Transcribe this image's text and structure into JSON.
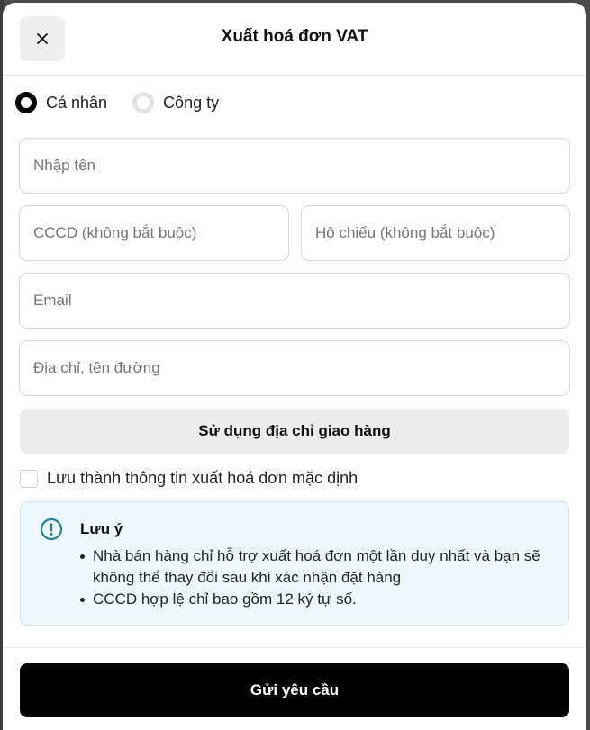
{
  "header": {
    "title": "Xuất hoá đơn VAT",
    "close_icon": "close-icon"
  },
  "customer_type": {
    "options": [
      {
        "label": "Cá nhân",
        "selected": true
      },
      {
        "label": "Công ty",
        "selected": false
      }
    ]
  },
  "form": {
    "name_placeholder": "Nhập tên",
    "cccd_placeholder": "CCCD (không bắt buộc)",
    "passport_placeholder": "Hộ chiếu (không bắt buộc)",
    "email_placeholder": "Email",
    "address_placeholder": "Địa chỉ, tên đường",
    "use_shipping_address_label": "Sử dụng địa chỉ giao hàng",
    "save_default_label": "Lưu thành thông tin xuất hoá đơn mặc định",
    "save_default_checked": false
  },
  "note": {
    "icon": "info-icon",
    "title": "Lưu ý",
    "items": [
      "Nhà bán hàng chỉ hỗ trợ xuất hoá đơn một lần duy nhất và bạn sẽ không thể thay đổi sau khi xác nhận đặt hàng",
      "CCCD hợp lệ chỉ bao gồm 12 ký tự số."
    ]
  },
  "footer": {
    "submit_label": "Gửi yêu cầu"
  },
  "colors": {
    "accent": "#000000",
    "note_bg": "#eef8fc",
    "note_icon": "#1f7f93"
  }
}
